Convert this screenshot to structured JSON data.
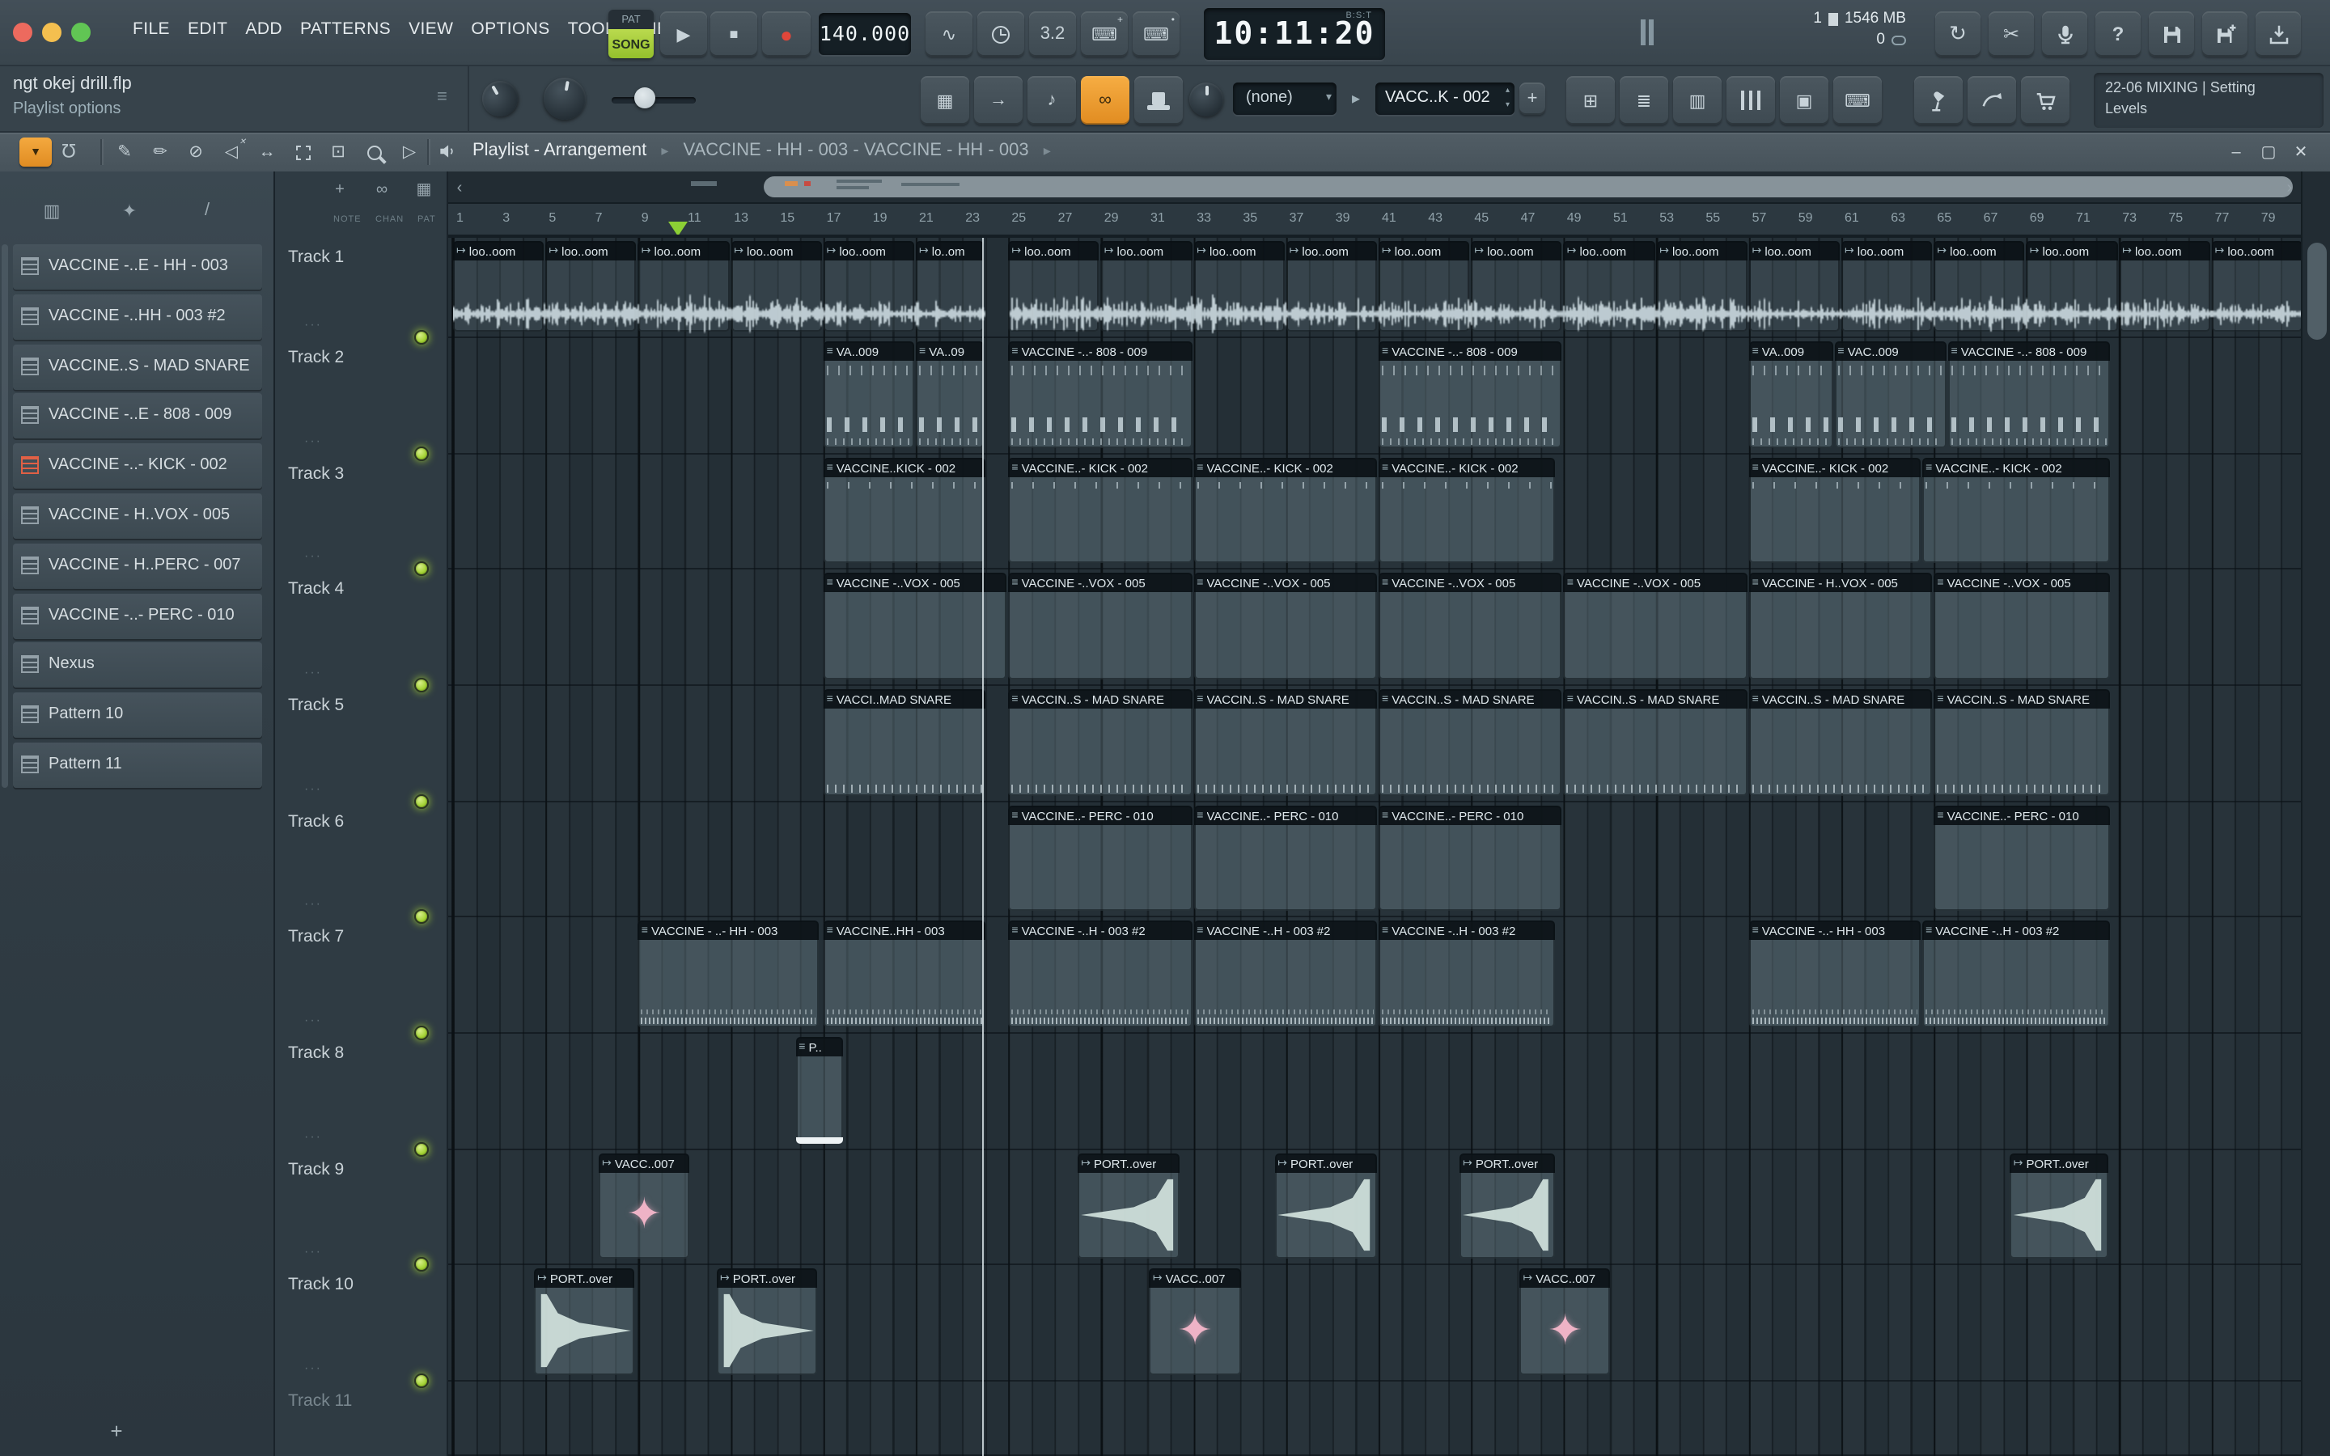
{
  "glyphs": {
    "play": "▶",
    "stop": "■",
    "record": "●",
    "spinner_up": "▴",
    "spinner_down": "▾",
    "dropdown": "▾",
    "arrow_right": "▸",
    "menu_arrow": "▼",
    "breadcrumb_sep": "▸",
    "chevron_left": "‹",
    "chevron_right": "›",
    "minus": "–",
    "window": "▢",
    "close": "✕",
    "help": "?",
    "sync": "↻",
    "scissors": "✂",
    "magnet": "Ω",
    "hint": "≡",
    "link": "∞",
    "grid": "▦"
  },
  "window": {
    "menu": [
      "FILE",
      "EDIT",
      "ADD",
      "PATTERNS",
      "VIEW",
      "OPTIONS",
      "TOOLS",
      "HELP"
    ]
  },
  "transport": {
    "pat": "PAT",
    "song": "SONG",
    "tempo": "140.000",
    "time": "10:11:20",
    "time_label": "B:S:T",
    "memory": {
      "cpu": "1",
      "ram": "1546 MB",
      "aux": "0"
    },
    "icon_buttons": [
      {
        "name": "pulse-icon",
        "glyph": "∿"
      },
      {
        "name": "wait-icon",
        "glyph": "",
        "cls": "clockg"
      },
      {
        "name": "countdown-icon",
        "glyph": "3.2"
      },
      {
        "name": "typing-keyboard-icon",
        "glyph": "⌨",
        "badge": "+"
      },
      {
        "name": "loop-record-icon",
        "glyph": "⌨",
        "badge": "•"
      }
    ]
  },
  "toolbar2": {
    "hint_title": "ngt okej drill.flp",
    "hint_sub": "Playlist options",
    "none_value": "(none)",
    "pattern_value": "VACC..K - 002",
    "add_label": "+",
    "session_line1": "22-06  MIXING | Setting",
    "session_line2": "Levels",
    "mode_buttons": [
      {
        "name": "step-grid-icon",
        "glyph": "▦"
      },
      {
        "name": "arrow-icon",
        "glyph": "→"
      },
      {
        "name": "note-icon",
        "glyph": "♪"
      },
      {
        "name": "link-icon",
        "glyph": "∞",
        "active": true
      },
      {
        "name": "top-hat-icon",
        "glyph": "",
        "cls": "hatg"
      }
    ],
    "right_buttons": [
      {
        "name": "plugin-window-icon",
        "glyph": "⊞"
      },
      {
        "name": "rows-icon",
        "glyph": "≣"
      },
      {
        "name": "columns-icon",
        "glyph": "▥"
      },
      {
        "name": "mixer-icon",
        "glyph": "",
        "cls": "mixerg"
      },
      {
        "name": "copy-icon",
        "glyph": "▣"
      },
      {
        "name": "keyboard-icon",
        "glyph": "⌨"
      }
    ]
  },
  "toolbar3": {
    "breadcrumb_primary": "Playlist - Arrangement",
    "breadcrumb_secondary": "VACCINE - HH - 003 - VACCINE - HH - 003",
    "tools": [
      {
        "name": "draw-tool-icon",
        "glyph": "✎"
      },
      {
        "name": "paint-tool-icon",
        "glyph": "✏"
      },
      {
        "name": "delete-tool-icon",
        "glyph": "⊘"
      },
      {
        "name": "mute-tool-icon",
        "glyph": "◁",
        "badge": "✕"
      },
      {
        "name": "slip-tool-icon",
        "glyph": "↔"
      },
      {
        "name": "select-tool-icon",
        "glyph": "",
        "cls": "selboxg"
      },
      {
        "name": "zoom-area-tool-icon",
        "glyph": "⊡"
      },
      {
        "name": "zoom-tool-icon",
        "glyph": "",
        "cls": "lensg"
      },
      {
        "name": "preview-tool-icon",
        "glyph": "▷"
      }
    ]
  },
  "picker": {
    "header_icons": [
      {
        "name": "patterns-view-icon",
        "glyph": "▥"
      },
      {
        "name": "sparkle-view-icon",
        "glyph": "✦"
      },
      {
        "name": "automation-view-icon",
        "glyph": "/"
      }
    ],
    "items": [
      {
        "label": "VACCINE -..E - HH - 003"
      },
      {
        "label": "VACCINE -..HH - 003 #2"
      },
      {
        "label": "VACCINE..S - MAD SNARE"
      },
      {
        "label": "VACCINE -..E - 808 - 009"
      },
      {
        "label": "VACCINE -..- KICK - 002",
        "marked": true
      },
      {
        "label": "VACCINE - H..VOX - 005"
      },
      {
        "label": "VACCINE - H..PERC - 007"
      },
      {
        "label": "VACCINE -..- PERC - 010"
      },
      {
        "label": "Nexus"
      },
      {
        "label": "Pattern 10"
      },
      {
        "label": "Pattern 11"
      }
    ],
    "add_label": "+"
  },
  "playlist": {
    "corner_icons": [
      {
        "name": "focus-playhead-icon",
        "glyph": "+"
      },
      {
        "name": "link-clips-icon",
        "glyph": "∞"
      },
      {
        "name": "grid-icon",
        "glyph": "▦"
      }
    ],
    "corner_labels": [
      "NOTE",
      "CHAN",
      "PAT"
    ],
    "ruler": {
      "start": 1,
      "end": 79,
      "step": 2
    },
    "marker_bar": 10.7,
    "playhead_bar": 23.9,
    "icons": {
      "midi_clip": "≡",
      "audio_clip": "↦"
    },
    "tracks": [
      {
        "name": "Track 1",
        "kind": "loop",
        "clips": [
          {
            "t": "loo..oom",
            "s": 1,
            "l": 4
          },
          {
            "t": "loo..oom",
            "s": 5,
            "l": 4
          },
          {
            "t": "loo..oom",
            "s": 9,
            "l": 4
          },
          {
            "t": "loo..oom",
            "s": 13,
            "l": 4
          },
          {
            "t": "loo..oom",
            "s": 17,
            "l": 4
          },
          {
            "t": "lo..om",
            "s": 21,
            "l": 3
          },
          {
            "t": "loo..oom",
            "s": 25,
            "l": 4
          },
          {
            "t": "loo..oom",
            "s": 29,
            "l": 4
          },
          {
            "t": "loo..oom",
            "s": 33,
            "l": 4
          },
          {
            "t": "loo..oom",
            "s": 37,
            "l": 4
          },
          {
            "t": "loo..oom",
            "s": 41,
            "l": 4
          },
          {
            "t": "loo..oom",
            "s": 45,
            "l": 4
          },
          {
            "t": "loo..oom",
            "s": 49,
            "l": 4
          },
          {
            "t": "loo..oom",
            "s": 53,
            "l": 4
          },
          {
            "t": "loo..oom",
            "s": 57,
            "l": 4
          },
          {
            "t": "loo..oom",
            "s": 61,
            "l": 4
          },
          {
            "t": "loo..oom",
            "s": 65,
            "l": 4
          },
          {
            "t": "loo..oom",
            "s": 69,
            "l": 4
          },
          {
            "t": "loo..oom",
            "s": 73,
            "l": 4
          },
          {
            "t": "loo..oom",
            "s": 77,
            "l": 4
          }
        ]
      },
      {
        "name": "Track 2",
        "kind": "m808",
        "clips": [
          {
            "t": "VA..009",
            "s": 17,
            "l": 4
          },
          {
            "t": "VA..09",
            "s": 21,
            "l": 3
          },
          {
            "t": "VACCINE -..- 808 - 009",
            "s": 25,
            "l": 8
          },
          {
            "t": "VACCINE -..- 808 - 009",
            "s": 41,
            "l": 8
          },
          {
            "t": "VA..009",
            "s": 57,
            "l": 3.7
          },
          {
            "t": "VAC..009",
            "s": 60.7,
            "l": 4.9
          },
          {
            "t": "VACCINE -..- 808 - 009",
            "s": 65.6,
            "l": 7.1
          }
        ]
      },
      {
        "name": "Track 3",
        "kind": "kick",
        "clips": [
          {
            "t": "VACCINE..KICK - 002",
            "s": 17,
            "l": 7.1
          },
          {
            "t": "VACCINE..- KICK - 002",
            "s": 25,
            "l": 8
          },
          {
            "t": "VACCINE..- KICK - 002",
            "s": 33,
            "l": 8
          },
          {
            "t": "VACCINE..- KICK - 002",
            "s": 41,
            "l": 7.7
          },
          {
            "t": "VACCINE..- KICK - 002",
            "s": 57,
            "l": 7.5
          },
          {
            "t": "VACCINE..- KICK - 002",
            "s": 64.5,
            "l": 8.2
          }
        ]
      },
      {
        "name": "Track 4",
        "kind": "vox",
        "clips": [
          {
            "t": "VACCINE -..VOX - 005",
            "s": 17,
            "l": 8
          },
          {
            "t": "VACCINE -..VOX - 005",
            "s": 25,
            "l": 8
          },
          {
            "t": "VACCINE -..VOX - 005",
            "s": 33,
            "l": 8
          },
          {
            "t": "VACCINE -..VOX - 005",
            "s": 41,
            "l": 8
          },
          {
            "t": "VACCINE -..VOX - 005",
            "s": 49,
            "l": 8
          },
          {
            "t": "VACCINE - H..VOX - 005",
            "s": 57,
            "l": 8
          },
          {
            "t": "VACCINE -..VOX - 005",
            "s": 65,
            "l": 7.7
          }
        ]
      },
      {
        "name": "Track 5",
        "kind": "snare",
        "clips": [
          {
            "t": "VACCI..MAD SNARE",
            "s": 17,
            "l": 7.1
          },
          {
            "t": "VACCIN..S - MAD SNARE",
            "s": 25,
            "l": 8
          },
          {
            "t": "VACCIN..S - MAD SNARE",
            "s": 33,
            "l": 8
          },
          {
            "t": "VACCIN..S - MAD SNARE",
            "s": 41,
            "l": 8
          },
          {
            "t": "VACCIN..S - MAD SNARE",
            "s": 49,
            "l": 8
          },
          {
            "t": "VACCIN..S - MAD SNARE",
            "s": 57,
            "l": 8
          },
          {
            "t": "VACCIN..S - MAD SNARE",
            "s": 65,
            "l": 7.7
          }
        ]
      },
      {
        "name": "Track 6",
        "kind": "perc",
        "clips": [
          {
            "t": "VACCINE..- PERC - 010",
            "s": 25,
            "l": 8
          },
          {
            "t": "VACCINE..- PERC - 010",
            "s": 33,
            "l": 8
          },
          {
            "t": "VACCINE..- PERC - 010",
            "s": 41,
            "l": 8
          },
          {
            "t": "VACCINE..- PERC - 010",
            "s": 65,
            "l": 7.7
          }
        ]
      },
      {
        "name": "Track 7",
        "kind": "hh",
        "clips": [
          {
            "t": "VACCINE - ..- HH - 003",
            "s": 9,
            "l": 7.9
          },
          {
            "t": "VACCINE..HH - 003",
            "s": 17,
            "l": 7.1
          },
          {
            "t": "VACCINE -..H - 003 #2",
            "s": 25,
            "l": 8
          },
          {
            "t": "VACCINE -..H - 003 #2",
            "s": 33,
            "l": 8
          },
          {
            "t": "VACCINE -..H - 003 #2",
            "s": 41,
            "l": 7.7
          },
          {
            "t": "VACCINE -..- HH - 003",
            "s": 57,
            "l": 7.5
          },
          {
            "t": "VACCINE -..H - 003 #2",
            "s": 64.5,
            "l": 8.2
          }
        ]
      },
      {
        "name": "Track 8",
        "kind": "plain",
        "clips": [
          {
            "t": "P..",
            "s": 15.8,
            "l": 2.1,
            "sel": true
          }
        ]
      },
      {
        "name": "Track 9",
        "kind": "audio",
        "clips": [
          {
            "t": "VACC..007",
            "s": 7.3,
            "l": 4,
            "k": "star"
          },
          {
            "t": "PORT..over",
            "s": 28,
            "l": 4.5,
            "k": "riser"
          },
          {
            "t": "PORT..over",
            "s": 36.5,
            "l": 4.5,
            "k": "riser"
          },
          {
            "t": "PORT..over",
            "s": 44.5,
            "l": 4.2,
            "k": "riser"
          },
          {
            "t": "PORT..over",
            "s": 68.3,
            "l": 4.3,
            "k": "riser"
          }
        ]
      },
      {
        "name": "Track 10",
        "kind": "audio",
        "clips": [
          {
            "t": "PORT..over",
            "s": 4.5,
            "l": 4.4,
            "k": "fall"
          },
          {
            "t": "PORT..over",
            "s": 12.4,
            "l": 4.4,
            "k": "fall"
          },
          {
            "t": "VACC..007",
            "s": 31.1,
            "l": 4,
            "k": "star"
          },
          {
            "t": "VACC..007",
            "s": 47.1,
            "l": 4,
            "k": "star"
          }
        ]
      },
      {
        "name": "Track 11",
        "dim": true,
        "clips": []
      }
    ]
  }
}
